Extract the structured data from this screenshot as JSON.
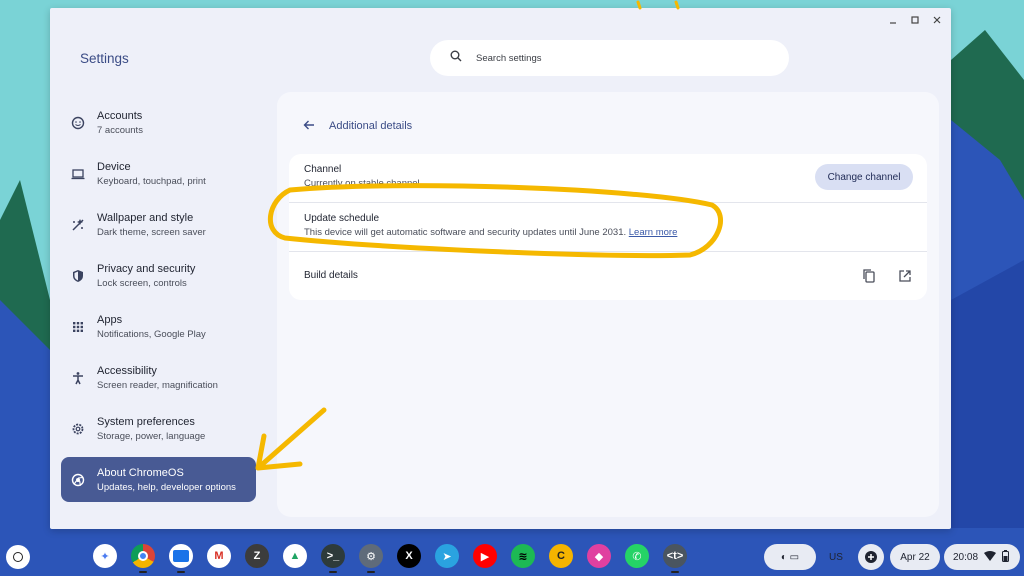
{
  "window": {
    "title": "Settings",
    "controls": [
      "minimize-icon",
      "maximize-icon",
      "close-icon"
    ]
  },
  "search": {
    "placeholder": "Search settings",
    "icon": "search-icon"
  },
  "sidebar": {
    "items": [
      {
        "label": "Accounts",
        "sub": "7 accounts",
        "icon": "account-icon"
      },
      {
        "label": "Device",
        "sub": "Keyboard, touchpad, print",
        "icon": "laptop-icon"
      },
      {
        "label": "Wallpaper and style",
        "sub": "Dark theme, screen saver",
        "icon": "palette-icon"
      },
      {
        "label": "Privacy and security",
        "sub": "Lock screen, controls",
        "icon": "shield-icon"
      },
      {
        "label": "Apps",
        "sub": "Notifications, Google Play",
        "icon": "apps-grid-icon"
      },
      {
        "label": "Accessibility",
        "sub": "Screen reader, magnification",
        "icon": "accessibility-icon"
      },
      {
        "label": "System preferences",
        "sub": "Storage, power, language",
        "icon": "gear-icon"
      },
      {
        "label": "About ChromeOS",
        "sub": "Updates, help, developer options",
        "icon": "chromeos-icon",
        "active": true
      }
    ]
  },
  "main": {
    "title": "Additional details",
    "channel": {
      "title": "Channel",
      "subtitle": "Currently on stable channel",
      "button": "Change channel"
    },
    "update_schedule": {
      "title": "Update schedule",
      "subtitle": "This device will get automatic software and security updates until June 2031.",
      "link": "Learn more"
    },
    "build_details": {
      "title": "Build details"
    }
  },
  "shelf": {
    "apps": [
      {
        "name": "gemini",
        "glyph": "✦",
        "bg": "#ffffff",
        "fg": "#4c7cf0"
      },
      {
        "name": "chrome",
        "glyph": "",
        "bg": "#ffffff",
        "fg": "#000000",
        "running": true
      },
      {
        "name": "files",
        "glyph": "",
        "bg": "#ffffff",
        "fg": "#1a73e8",
        "running": true
      },
      {
        "name": "gmail",
        "glyph": "M",
        "bg": "#ffffff",
        "fg": "#d93025"
      },
      {
        "name": "zotero",
        "glyph": "Z",
        "bg": "#3c3c3c",
        "fg": "#ffffff"
      },
      {
        "name": "drive",
        "glyph": "▲",
        "bg": "#ffffff",
        "fg": "#1fa463"
      },
      {
        "name": "terminal",
        "glyph": ">_",
        "bg": "#2e3b3b",
        "fg": "#ffffff",
        "running": true
      },
      {
        "name": "settings",
        "glyph": "⚙",
        "bg": "#5f6b7a",
        "fg": "#ffffff",
        "running": true
      },
      {
        "name": "x",
        "glyph": "X",
        "bg": "#000000",
        "fg": "#ffffff"
      },
      {
        "name": "telegram",
        "glyph": "➤",
        "bg": "#2aa3e0",
        "fg": "#ffffff"
      },
      {
        "name": "youtube",
        "glyph": "▶",
        "bg": "#ff0000",
        "fg": "#ffffff"
      },
      {
        "name": "spotify",
        "glyph": "≋",
        "bg": "#1db954",
        "fg": "#000000"
      },
      {
        "name": "c-app",
        "glyph": "C",
        "bg": "#f5b400",
        "fg": "#222222"
      },
      {
        "name": "pink-app",
        "glyph": "◆",
        "bg": "#e040a0",
        "fg": "#ffffff"
      },
      {
        "name": "whatsapp",
        "glyph": "✆",
        "bg": "#25d366",
        "fg": "#ffffff"
      },
      {
        "name": "text-app",
        "glyph": "<t>",
        "bg": "#4a5560",
        "fg": "#ffffff",
        "running": true
      }
    ],
    "tray": {
      "ime": "US",
      "date": "Apr 22",
      "time": "20:08"
    }
  },
  "colors": {
    "accent": "#485a94",
    "annotation": "#f5b800"
  }
}
